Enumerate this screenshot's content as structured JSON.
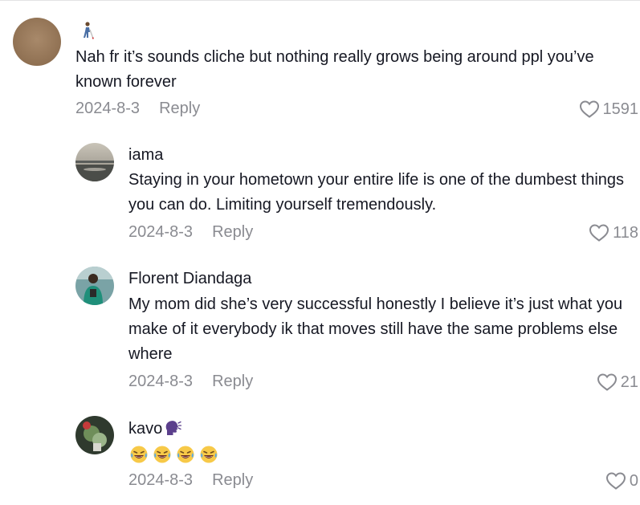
{
  "comments": [
    {
      "username": "",
      "username_emoji": "person-with-cane-emoji",
      "text": "Nah fr it’s sounds cliche but nothing really grows being around ppl you’ve known forever",
      "date": "2024-8-3",
      "reply_label": "Reply",
      "likes": "1591"
    },
    {
      "username": "iama",
      "text": "Staying in your hometown your entire life is one of the dumbest things you can do. Limiting yourself tremendously.",
      "date": "2024-8-3",
      "reply_label": "Reply",
      "likes": "118"
    },
    {
      "username": "Florent Diandaga",
      "text": "My mom did she’s very successful honestly I believe it’s just what you make of it everybody ik that moves still have the same problems else where",
      "date": "2024-8-3",
      "reply_label": "Reply",
      "likes": "21"
    },
    {
      "username": "kavo",
      "username_emoji": "speaking-head-emoji",
      "text_emojis": [
        "laughing-tears-emoji",
        "laughing-tears-emoji",
        "laughing-tears-emoji",
        "laughing-tears-emoji"
      ],
      "date": "2024-8-3",
      "reply_label": "Reply",
      "likes": "0"
    }
  ],
  "colors": {
    "primary_text": "#161823",
    "secondary_text": "#8a8b91",
    "divider": "#e3e3e4"
  }
}
